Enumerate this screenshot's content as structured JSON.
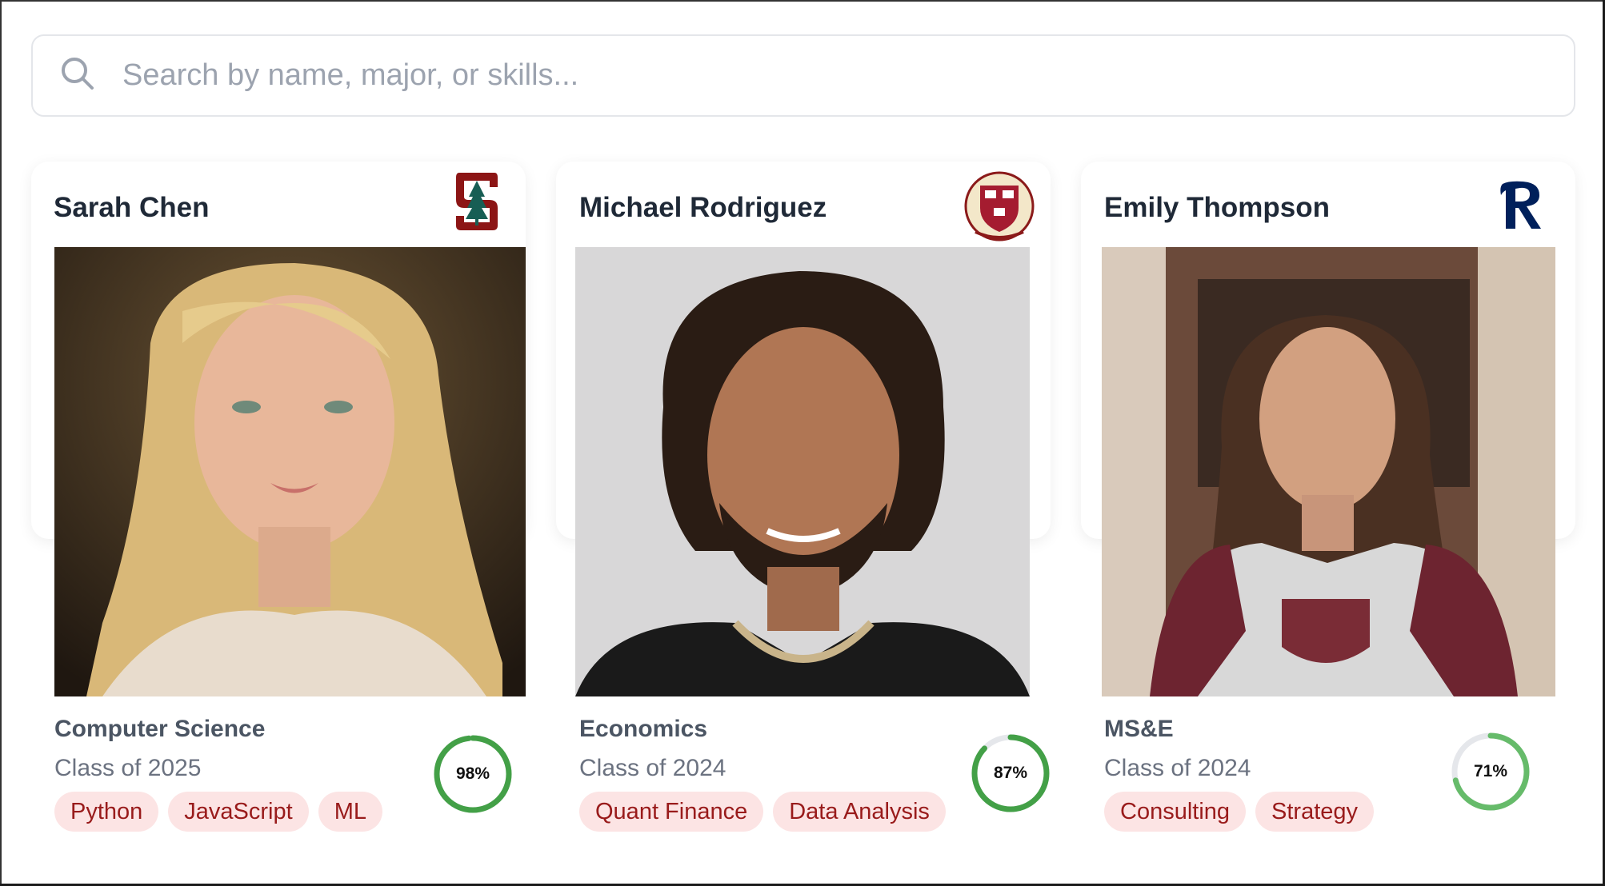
{
  "search": {
    "placeholder": "Search by name, major, or skills...",
    "icon": "search-icon"
  },
  "colors": {
    "tag_bg": "#fce4e4",
    "tag_text": "#991b1b",
    "score_ring": "#43a047",
    "score_track": "#e5e7eb"
  },
  "students": [
    {
      "name": "Sarah Chen",
      "school_logo": "stanford-logo",
      "major": "Computer Science",
      "class_year": "Class of 2025",
      "tags": [
        "Python",
        "JavaScript",
        "ML"
      ],
      "match_percent": 98,
      "match_label": "98%"
    },
    {
      "name": "Michael Rodriguez",
      "school_logo": "harvard-logo",
      "major": "Economics",
      "class_year": "Class of 2024",
      "tags": [
        "Quant Finance",
        "Data Analysis"
      ],
      "match_percent": 87,
      "match_label": "87%"
    },
    {
      "name": "Emily Thompson",
      "school_logo": "rice-logo",
      "major": "MS&E",
      "class_year": "Class of 2024",
      "tags": [
        "Consulting",
        "Strategy"
      ],
      "match_percent": 71,
      "match_label": "71%"
    }
  ]
}
